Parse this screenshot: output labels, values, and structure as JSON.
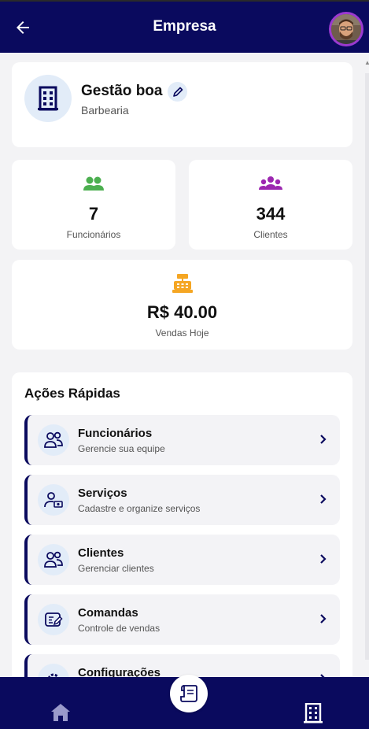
{
  "header": {
    "title": "Empresa",
    "back_icon": "arrow-left-icon",
    "avatar_icon": "user-avatar"
  },
  "company": {
    "name": "Gestão boa",
    "type": "Barbearia",
    "logo_icon": "building-icon",
    "edit_icon": "pencil-icon"
  },
  "stats": {
    "employees": {
      "value": "7",
      "label": "Funcionários",
      "icon": "people-icon",
      "color": "#4caf50"
    },
    "clients": {
      "value": "344",
      "label": "Clientes",
      "icon": "group-icon",
      "color": "#9c27b0"
    },
    "sales": {
      "value": "R$ 40.00",
      "label": "Vendas Hoje",
      "icon": "cash-register-icon",
      "color": "#f5a623"
    }
  },
  "quick_actions": {
    "title": "Ações Rápidas",
    "items": [
      {
        "name": "Funcionários",
        "subtitle": "Gerencie sua equipe",
        "icon": "people-outline-icon"
      },
      {
        "name": "Serviços",
        "subtitle": "Cadastre e organize serviços",
        "icon": "user-money-icon"
      },
      {
        "name": "Clientes",
        "subtitle": "Gerenciar clientes",
        "icon": "people-outline-icon"
      },
      {
        "name": "Comandas",
        "subtitle": "Controle de vendas",
        "icon": "receipt-edit-icon"
      },
      {
        "name": "Configurações",
        "subtitle": "",
        "icon": "gear-icon"
      }
    ]
  },
  "bottom_nav": {
    "home_icon": "home-icon",
    "center_icon": "receipt-icon",
    "company_icon": "building-icon"
  },
  "colors": {
    "primary": "#0a0a5e",
    "background": "#f3f3f5",
    "icon_bg": "#e2ecf8"
  }
}
